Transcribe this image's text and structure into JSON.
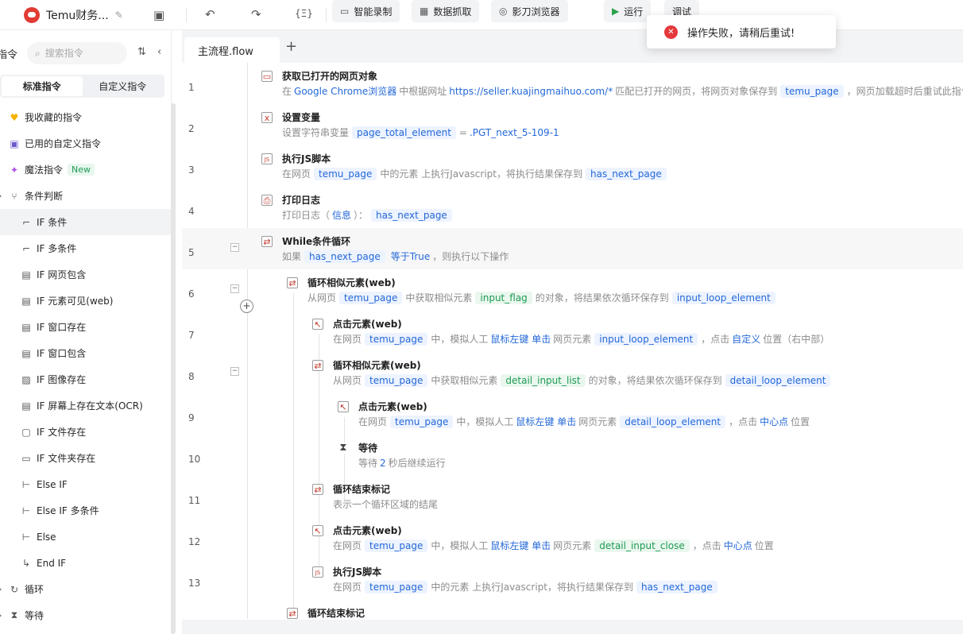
{
  "app": {
    "title": "Temu财务..."
  },
  "toolbar": {
    "buttons": [
      {
        "label": "智能录制",
        "icon": "video-icon"
      },
      {
        "label": "数据抓取",
        "icon": "table-icon"
      },
      {
        "label": "影刀浏览器",
        "icon": "browser-icon"
      },
      {
        "label": "运行",
        "icon": "play-icon"
      },
      {
        "label": "调试",
        "icon": "bug-icon"
      }
    ],
    "var_icon": "{Ξ}"
  },
  "toast": {
    "message": "操作失败，请稍后重试!",
    "color": "#e5383b"
  },
  "sidebar": {
    "title": "指令",
    "search_placeholder": "搜索指令",
    "tabs": [
      "标准指令",
      "自定义指令"
    ],
    "items": [
      {
        "label": "我收藏的指令",
        "icon": "heart-icon",
        "glyph": "♥",
        "level": 0
      },
      {
        "label": "已用的自定义指令",
        "icon": "calendar-icon",
        "glyph": "▣",
        "level": 0
      },
      {
        "label": "魔法指令",
        "icon": "sparkle-icon",
        "glyph": "✦",
        "level": 0,
        "badge": "New"
      },
      {
        "label": "条件判断",
        "icon": "branch-icon",
        "glyph": "⑂",
        "level": 0,
        "arrow": "›"
      },
      {
        "label": "IF 条件",
        "icon": "if-icon",
        "glyph": "⌐",
        "level": 1,
        "selected": true
      },
      {
        "label": "IF 多条件",
        "icon": "if-multi-icon",
        "glyph": "⌐",
        "level": 1
      },
      {
        "label": "IF 网页包含",
        "icon": "web-contains-icon",
        "glyph": "▤",
        "level": 1
      },
      {
        "label": "IF 元素可见(web)",
        "icon": "element-visible-icon",
        "glyph": "▤",
        "level": 1
      },
      {
        "label": "IF 窗口存在",
        "icon": "window-exists-icon",
        "glyph": "▤",
        "level": 1
      },
      {
        "label": "IF 窗口包含",
        "icon": "window-contains-icon",
        "glyph": "▤",
        "level": 1
      },
      {
        "label": "IF 图像存在",
        "icon": "image-exists-icon",
        "glyph": "▨",
        "level": 1
      },
      {
        "label": "IF 屏幕上存在文本(OCR)",
        "icon": "ocr-icon",
        "glyph": "▤",
        "level": 1
      },
      {
        "label": "IF 文件存在",
        "icon": "file-exists-icon",
        "glyph": "▢",
        "level": 1
      },
      {
        "label": "IF 文件夹存在",
        "icon": "folder-exists-icon",
        "glyph": "▭",
        "level": 1
      },
      {
        "label": "Else IF",
        "icon": "else-if-icon",
        "glyph": "⊢",
        "level": 1
      },
      {
        "label": "Else IF 多条件",
        "icon": "else-if-multi-icon",
        "glyph": "⊢",
        "level": 1
      },
      {
        "label": "Else",
        "icon": "else-icon",
        "glyph": "⊢",
        "level": 1
      },
      {
        "label": "End IF",
        "icon": "end-if-icon",
        "glyph": "↳",
        "level": 1
      },
      {
        "label": "循环",
        "icon": "loop-icon",
        "glyph": "↻",
        "level": 0,
        "arrow": "›"
      },
      {
        "label": "等待",
        "icon": "hourglass-icon",
        "glyph": "⧗",
        "level": 0,
        "arrow": "›"
      }
    ]
  },
  "editor": {
    "tab": "主流程.flow",
    "add_tab": "+",
    "rows": [
      {
        "num": "1",
        "indent": 0,
        "icon": "browser-object-icon",
        "glyph": "▭",
        "title": "获取已打开的网页对象",
        "desc": [
          [
            "t",
            "在"
          ],
          [
            "l",
            "Google Chrome浏览器"
          ],
          [
            "t",
            "中根据网址"
          ],
          [
            "l",
            "https://seller.kuajingmaihuo.com/*"
          ],
          [
            "t",
            "匹配已打开的网页，将网页对象保存到"
          ],
          [
            "v",
            "temu_page"
          ],
          [
            "t",
            "，网页加载超时后重试此指令"
          ]
        ]
      },
      {
        "num": "2",
        "indent": 0,
        "icon": "variable-icon",
        "glyph": "x",
        "title": "设置变量",
        "desc": [
          [
            "t",
            "设置字符串变量"
          ],
          [
            "v",
            "page_total_element"
          ],
          [
            "t",
            "="
          ],
          [
            "l",
            ".PGT_next_5-109-1"
          ]
        ]
      },
      {
        "num": "3",
        "indent": 0,
        "icon": "js-script-icon",
        "glyph": "JS",
        "title": "执行JS脚本",
        "desc": [
          [
            "t",
            "在网页"
          ],
          [
            "v",
            "temu_page"
          ],
          [
            "t",
            "中的元素 上执行Javascript，将执行结果保存到"
          ],
          [
            "v",
            "has_next_page"
          ]
        ]
      },
      {
        "num": "4",
        "indent": 0,
        "icon": "print-log-icon",
        "glyph": "⎙",
        "title": "打印日志",
        "desc": [
          [
            "t",
            "打印日志（"
          ],
          [
            "l",
            "信息"
          ],
          [
            "t",
            "）："
          ],
          [
            "v",
            "has_next_page"
          ]
        ]
      },
      {
        "num": "5",
        "indent": 0,
        "icon": "while-loop-icon",
        "glyph": "⇄",
        "title": "While条件循环",
        "fold": true,
        "highlight": true,
        "desc": [
          [
            "t",
            "如果"
          ],
          [
            "v",
            "has_next_page"
          ],
          [
            "l",
            "等于True"
          ],
          [
            "t",
            "，则执行以下操作"
          ]
        ]
      },
      {
        "num": "6",
        "indent": 1,
        "icon": "loop-similar-icon",
        "glyph": "⇄",
        "title": "循环相似元素(web)",
        "fold": true,
        "desc": [
          [
            "t",
            "从网页"
          ],
          [
            "v",
            "temu_page"
          ],
          [
            "t",
            "中获取相似元素"
          ],
          [
            "g",
            "input_flag"
          ],
          [
            "t",
            "的对象，将结果依次循环保存到"
          ],
          [
            "v",
            "input_loop_element"
          ]
        ]
      },
      {
        "num": "7",
        "indent": 2,
        "icon": "click-element-icon",
        "glyph": "↖",
        "title": "点击元素(web)",
        "desc": [
          [
            "t",
            "在网页"
          ],
          [
            "v",
            "temu_page"
          ],
          [
            "t",
            "中，模拟人工"
          ],
          [
            "l",
            "鼠标左键 单击"
          ],
          [
            "t",
            "网页元素"
          ],
          [
            "v",
            "input_loop_element"
          ],
          [
            "t",
            "，点击"
          ],
          [
            "l",
            "自定义"
          ],
          [
            "t",
            "位置（右中部）"
          ]
        ]
      },
      {
        "num": "8",
        "indent": 2,
        "icon": "loop-similar-icon",
        "glyph": "⇄",
        "title": "循环相似元素(web)",
        "fold": true,
        "desc": [
          [
            "t",
            "从网页"
          ],
          [
            "v",
            "temu_page"
          ],
          [
            "t",
            "中获取相似元素"
          ],
          [
            "g",
            "detail_input_list"
          ],
          [
            "t",
            "的对象，将结果依次循环保存到"
          ],
          [
            "v",
            "detail_loop_element"
          ]
        ]
      },
      {
        "num": "9",
        "indent": 3,
        "icon": "click-element-icon",
        "glyph": "↖",
        "title": "点击元素(web)",
        "desc": [
          [
            "t",
            "在网页"
          ],
          [
            "v",
            "temu_page"
          ],
          [
            "t",
            "中，模拟人工"
          ],
          [
            "l",
            "鼠标左键 单击"
          ],
          [
            "t",
            "网页元素"
          ],
          [
            "v",
            "detail_loop_element"
          ],
          [
            "t",
            "，点击"
          ],
          [
            "l",
            "中心点"
          ],
          [
            "t",
            "位置"
          ]
        ]
      },
      {
        "num": "10",
        "indent": 3,
        "icon": "wait-icon",
        "glyph": "⧗",
        "title": "等待",
        "desc": [
          [
            "t",
            "等待"
          ],
          [
            "l",
            "2"
          ],
          [
            "t",
            "秒后继续运行"
          ]
        ]
      },
      {
        "num": "11",
        "indent": 2,
        "icon": "loop-end-icon",
        "glyph": "⇄",
        "title": "循环结束标记",
        "desc": [
          [
            "t",
            "表示一个循环区域的结尾"
          ]
        ]
      },
      {
        "num": "12",
        "indent": 2,
        "icon": "click-element-icon",
        "glyph": "↖",
        "title": "点击元素(web)",
        "desc": [
          [
            "t",
            "在网页"
          ],
          [
            "v",
            "temu_page"
          ],
          [
            "t",
            "中，模拟人工"
          ],
          [
            "l",
            "鼠标左键 单击"
          ],
          [
            "t",
            "网页元素"
          ],
          [
            "g",
            "detail_input_close"
          ],
          [
            "t",
            "，点击"
          ],
          [
            "l",
            "中心点"
          ],
          [
            "t",
            "位置"
          ]
        ]
      },
      {
        "num": "13",
        "indent": 2,
        "icon": "js-script-icon",
        "glyph": "JS",
        "title": "执行JS脚本",
        "desc": [
          [
            "t",
            "在网页"
          ],
          [
            "v",
            "temu_page"
          ],
          [
            "t",
            "中的元素 上执行Javascript，将执行结果保存到"
          ],
          [
            "v",
            "has_next_page"
          ]
        ]
      },
      {
        "num": "",
        "indent": 1,
        "icon": "loop-end-icon",
        "glyph": "⇄",
        "title": "循环结束标记",
        "desc": []
      }
    ]
  }
}
